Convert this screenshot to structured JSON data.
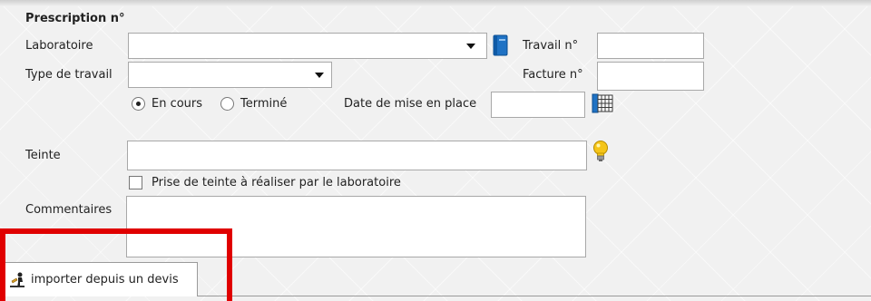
{
  "form": {
    "title": "Prescription n°",
    "laboratoire": {
      "label": "Laboratoire",
      "value": ""
    },
    "travail_num": {
      "label": "Travail n°",
      "value": ""
    },
    "type_travail": {
      "label": "Type de travail",
      "value": ""
    },
    "facture_num": {
      "label": "Facture n°",
      "value": ""
    },
    "status": {
      "options": [
        "En cours",
        "Terminé"
      ],
      "selected": "En cours"
    },
    "date_mise_en_place": {
      "label": "Date de mise en place",
      "value": ""
    },
    "teinte": {
      "label": "Teinte",
      "value": ""
    },
    "prise_de_teinte": {
      "label": "Prise de teinte à réaliser par le laboratoire",
      "checked": false
    },
    "commentaires": {
      "label": "Commentaires",
      "value": ""
    }
  },
  "tabs": [
    {
      "label": "importer depuis un devis",
      "icon": "import-figure-icon"
    }
  ],
  "colors": {
    "highlight_box": "#e00000",
    "bulb": "#f5c518",
    "book_icon": "#1f72c4"
  }
}
